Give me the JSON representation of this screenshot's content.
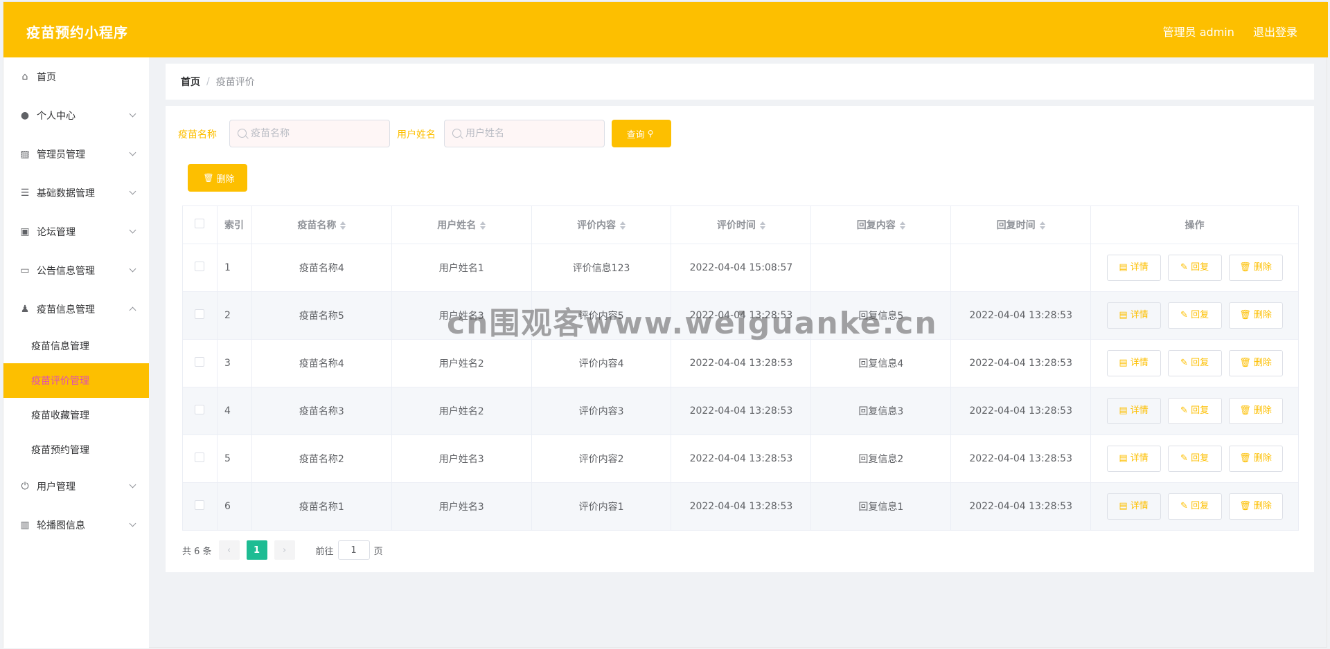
{
  "header": {
    "title": "疫苗预约小程序",
    "user": "管理员 admin",
    "logout": "退出登录"
  },
  "sidebar": {
    "items": [
      {
        "label": "首页",
        "icon": "home-icon"
      },
      {
        "label": "个人中心",
        "icon": "user-icon"
      },
      {
        "label": "管理员管理",
        "icon": "chart-icon"
      },
      {
        "label": "基础数据管理",
        "icon": "sliders-icon"
      },
      {
        "label": "论坛管理",
        "icon": "briefcase-icon"
      },
      {
        "label": "公告信息管理",
        "icon": "id-card-icon"
      },
      {
        "label": "疫苗信息管理",
        "icon": "person-icon"
      }
    ],
    "sub_items": [
      "疫苗信息管理",
      "疫苗评价管理",
      "疫苗收藏管理",
      "疫苗预约管理"
    ],
    "bottom_items": [
      {
        "label": "用户管理",
        "icon": "power-icon"
      },
      {
        "label": "轮播图信息",
        "icon": "library-icon"
      }
    ]
  },
  "breadcrumb": {
    "home": "首页",
    "separator": "/",
    "current": "疫苗评价"
  },
  "search": {
    "vaccine_label": "疫苗名称",
    "vaccine_placeholder": "疫苗名称",
    "user_label": "用户姓名",
    "user_placeholder": "用户姓名",
    "query_button": "查询"
  },
  "toolbar": {
    "delete_button": "删除"
  },
  "table": {
    "headers": [
      "索引",
      "疫苗名称",
      "用户姓名",
      "评价内容",
      "评价时间",
      "回复内容",
      "回复时间",
      "操作"
    ],
    "rows": [
      [
        "1",
        "疫苗名称4",
        "用户姓名1",
        "评价信息123",
        "2022-04-04 15:08:57",
        "",
        ""
      ],
      [
        "2",
        "疫苗名称5",
        "用户姓名3",
        "评价内容5",
        "2022-04-04 13:28:53",
        "回复信息5",
        "2022-04-04 13:28:53"
      ],
      [
        "3",
        "疫苗名称4",
        "用户姓名2",
        "评价内容4",
        "2022-04-04 13:28:53",
        "回复信息4",
        "2022-04-04 13:28:53"
      ],
      [
        "4",
        "疫苗名称3",
        "用户姓名2",
        "评价内容3",
        "2022-04-04 13:28:53",
        "回复信息3",
        "2022-04-04 13:28:53"
      ],
      [
        "5",
        "疫苗名称2",
        "用户姓名3",
        "评价内容2",
        "2022-04-04 13:28:53",
        "回复信息2",
        "2022-04-04 13:28:53"
      ],
      [
        "6",
        "疫苗名称1",
        "用户姓名3",
        "评价内容1",
        "2022-04-04 13:28:53",
        "回复信息1",
        "2022-04-04 13:28:53"
      ]
    ],
    "actions": {
      "detail": "详情",
      "reply": "回复",
      "delete": "删除"
    }
  },
  "pagination": {
    "total": "共 6 条",
    "current_page": "1",
    "goto_label": "前往",
    "goto_value": "1",
    "page_suffix": "页"
  },
  "watermark": "cn围观客www.weiguanke.cn",
  "colors": {
    "accent": "#fdbf00",
    "active_text": "#e04fb4",
    "pager_current": "#1ebc93"
  }
}
